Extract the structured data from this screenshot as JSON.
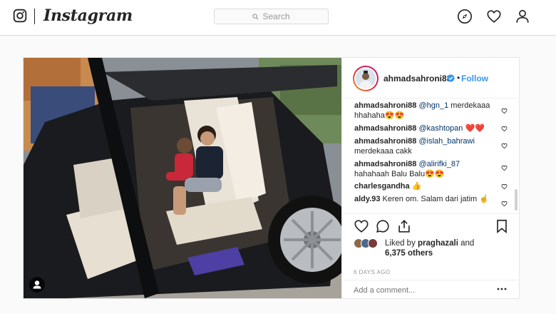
{
  "nav": {
    "brand": "Instagram",
    "search_placeholder": "Search",
    "icons": [
      "instagram-glyph-icon",
      "search-icon",
      "compass-icon",
      "heart-icon",
      "profile-icon"
    ]
  },
  "post": {
    "username": "ahmadsahroni88",
    "verified": true,
    "follow_label": "Follow",
    "separator": "•",
    "comments": [
      {
        "user": "ahmadsahroni88",
        "mention": "@hgn_1",
        "text": " merdekaaa hhahaha😍😍"
      },
      {
        "user": "ahmadsahroni88",
        "mention": "@kashtopan",
        "text": " ❤️❤️"
      },
      {
        "user": "ahmadsahroni88",
        "mention": "@islah_bahrawi",
        "text": " merdekaaa cakk"
      },
      {
        "user": "ahmadsahroni88",
        "mention": "@alirifki_87",
        "text": " hahahaah Balu Balu😍😍"
      },
      {
        "user": "charlesgandha",
        "mention": "",
        "text": " 👍"
      },
      {
        "user": "aldy.93",
        "mention": "",
        "text": " Keren om. Salam dari jatim ☝️"
      }
    ],
    "likes": {
      "prefix": "Liked by ",
      "user": "praghazali",
      "middle": " and",
      "count": "6,375 others"
    },
    "timestamp": "6 DAYS AGO",
    "add_comment_placeholder": "Add a comment..."
  },
  "colors": {
    "link_blue": "#3897f0",
    "border": "#dbdbdb",
    "text": "#262626",
    "muted": "#999999"
  }
}
